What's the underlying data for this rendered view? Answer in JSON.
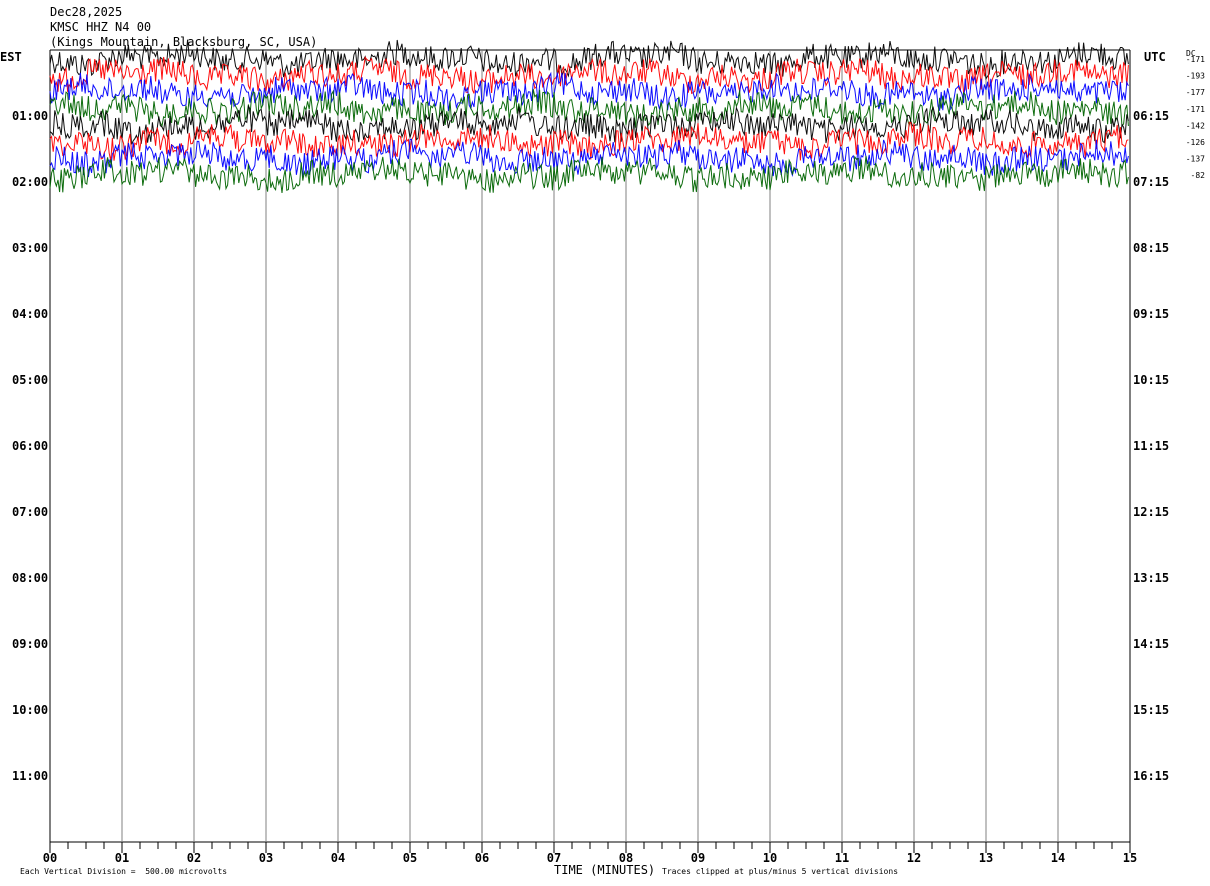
{
  "header": {
    "date": "Dec28,2025",
    "channel": "KMSC HHZ N4 00",
    "location": "(Kings Mountain, Blacksburg, SC, USA)"
  },
  "left_timezone": "EST",
  "right_timezone": "UTC",
  "dc_label": "DC",
  "footer": {
    "division_note": "Each Vertical Division =  500.00 microvolts",
    "xlabel": "TIME (MINUTES)",
    "clip_note": "Traces clipped at plus/minus 5 vertical divisions"
  },
  "colors": {
    "trace_cycle": [
      "#000000",
      "#ff0000",
      "#0000ff",
      "#006400"
    ],
    "grid": "#808080"
  },
  "chart_data": {
    "type": "line",
    "title": "KMSC HHZ N4 00",
    "xlabel": "TIME (MINUTES)",
    "x_ticks": [
      "00",
      "01",
      "02",
      "03",
      "04",
      "05",
      "06",
      "07",
      "08",
      "09",
      "10",
      "11",
      "12",
      "13",
      "14",
      "15"
    ],
    "xlim": [
      0,
      15
    ],
    "left_row_labels": [
      "01:00",
      "02:00",
      "03:00",
      "04:00",
      "05:00",
      "06:00",
      "07:00",
      "08:00",
      "09:00",
      "10:00",
      "11:00"
    ],
    "right_row_labels": [
      "06:15",
      "07:15",
      "08:15",
      "09:15",
      "10:15",
      "11:15",
      "12:15",
      "13:15",
      "14:15",
      "15:15",
      "16:15"
    ],
    "trace_count": 8,
    "trace_colors": [
      "#000000",
      "#ff0000",
      "#0000ff",
      "#006400",
      "#000000",
      "#ff0000",
      "#0000ff",
      "#006400"
    ],
    "dc_offsets": [
      "-171",
      "-193",
      "-177",
      "-171",
      "-142",
      "-126",
      "-137",
      "-82"
    ]
  }
}
